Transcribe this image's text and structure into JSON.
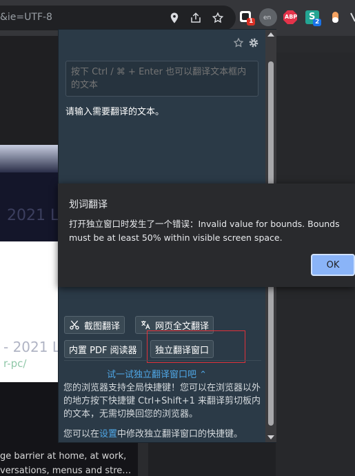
{
  "browser": {
    "url_fragment": "&ie=UTF-8",
    "extensions": [
      {
        "name": "translate-extension",
        "badge": "1"
      },
      {
        "name": "en-extension",
        "label": "en"
      },
      {
        "name": "adblock-extension",
        "label": "ABP"
      },
      {
        "name": "s-extension",
        "label": "S",
        "badge": "2"
      },
      {
        "name": "pill-extension"
      }
    ]
  },
  "page": {
    "title_fragment": "2021 L",
    "year_fragment": "- 2021 L",
    "sub_fragment": "r-pc/",
    "body_lines": [
      "ge barrier at home, at work,",
      "versations, menus and stre…"
    ]
  },
  "popup": {
    "textarea_placeholder": "按下 Ctrl / ⌘ + Enter 也可以翻译文本框内的文本",
    "prompt": "请输入需要翻译的文本。",
    "buttons": {
      "screenshot": "截图翻译",
      "webpage": "网页全文翻译",
      "pdf": "内置 PDF 阅读器",
      "standalone": "独立翻译窗口"
    },
    "try_link": "试一试独立翻译窗口吧 ⌃",
    "info_text": "您的浏览器支持全局快捷键！您可以在浏览器以外的地方按下快捷键 Ctrl+Shift+1 来翻译剪切板内的文本，无需切换回您的浏览器。",
    "settings_pre": "您可以在",
    "settings_link": "设置",
    "settings_post": "中修改独立翻译窗口的快捷键。"
  },
  "dialog": {
    "title": "划词翻译",
    "message": "打开独立窗口时发生了一个错误：Invalid value for bounds. Bounds must be at least 50% within visible screen space.",
    "ok_label": "OK"
  },
  "colors": {
    "popup_bg": "#2b3a47",
    "link": "#4fa7e6",
    "ok_button": "#8ab4f8",
    "highlight": "#e0313a"
  }
}
